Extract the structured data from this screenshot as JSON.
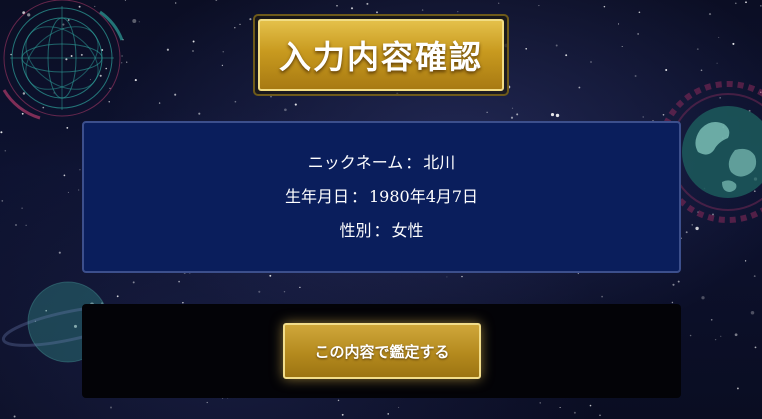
{
  "header": {
    "title": "入力内容確認"
  },
  "confirmation": {
    "nickname": {
      "label": "ニックネーム",
      "separator": "：",
      "value": "北川"
    },
    "birthdate": {
      "label": "生年月日",
      "separator": "：",
      "value": "1980年4月7日"
    },
    "gender": {
      "label": "性別",
      "separator": "：",
      "value": "女性"
    }
  },
  "actions": {
    "submit_label": "この内容で鑑定する"
  },
  "colors": {
    "gold": "#c89a1f",
    "info_box_bg": "#0a1e5c",
    "background": "#0d1230"
  }
}
